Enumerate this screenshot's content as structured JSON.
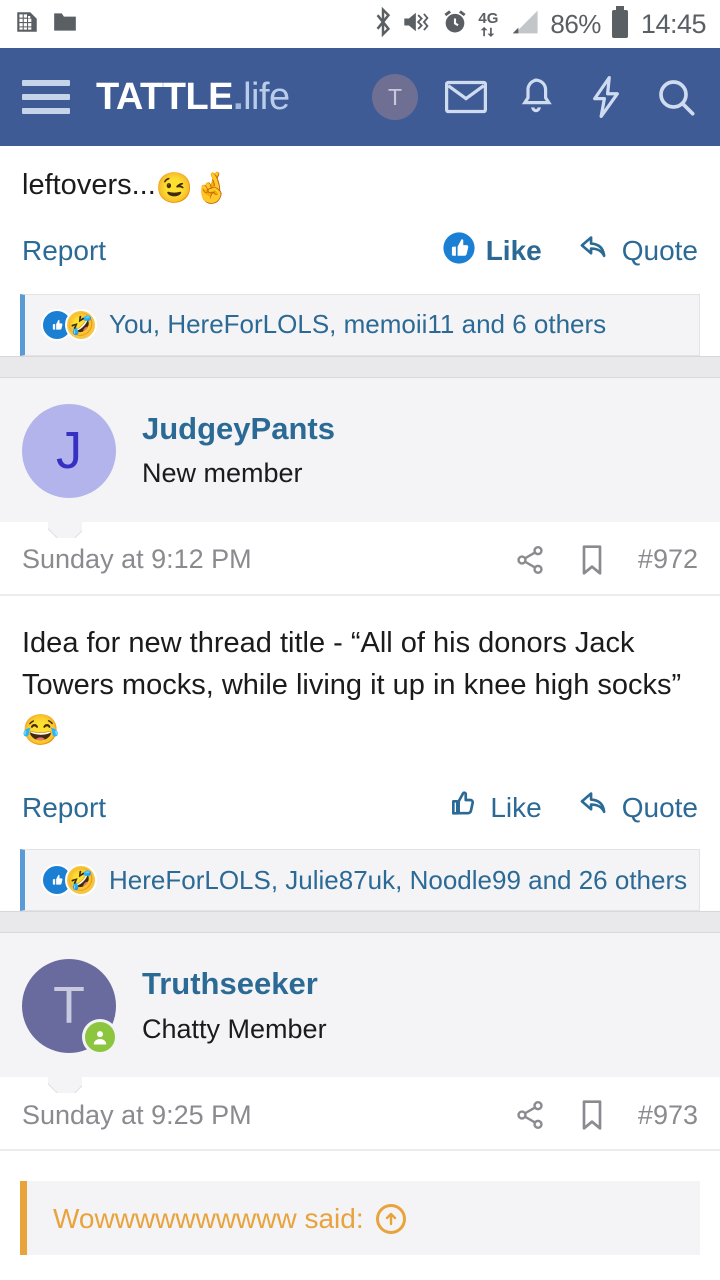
{
  "statusbar": {
    "icons": [
      "sim-card-icon",
      "folder-icon",
      "bluetooth-icon",
      "mute-vibrate-icon",
      "alarm-icon",
      "4g-data-icon",
      "signal-icon",
      "battery-icon"
    ],
    "network_label": "4G",
    "battery_percent": "86%",
    "clock": "14:45"
  },
  "navbar": {
    "menu_icon": "hamburger-menu-icon",
    "logo_main": "TATTLE",
    "logo_dot": ".",
    "logo_sub": "life",
    "avatar_initial": "T",
    "icons": [
      "inbox-icon",
      "alerts-bell-icon",
      "lightning-icon",
      "search-icon"
    ],
    "background": "#3f5b96"
  },
  "posts": [
    {
      "body_tail": "leftovers...",
      "body_emoji": [
        "😉",
        "🤞"
      ],
      "report_label": "Report",
      "like_label": "Like",
      "quote_label": "Quote",
      "liked": true,
      "reactions_text": "You, HereForLOLS, memoii11 and 6 others"
    },
    {
      "username": "JudgeyPants",
      "usertitle": "New member",
      "avatar_initial": "J",
      "avatar_bg": "#b3b4ec",
      "avatar_fg": "#3730c4",
      "online": false,
      "date": "Sunday at 9:12 PM",
      "post_number": "#972",
      "body": "Idea for new thread title - “All of his donors Jack Towers mocks, while living it up in knee high socks”",
      "body_emoji": "😂",
      "report_label": "Report",
      "like_label": "Like",
      "quote_label": "Quote",
      "liked": false,
      "reactions_text": "HereForLOLS, Julie87uk, Noodle99 and 26 others"
    },
    {
      "username": "Truthseeker",
      "usertitle": "Chatty Member",
      "avatar_initial": "T",
      "avatar_bg": "#696a9e",
      "avatar_fg": "#c9cade",
      "online": true,
      "date": "Sunday at 9:25 PM",
      "post_number": "#973",
      "quote_author": "Wowwwwwwwwww said:",
      "quote_jump_icon": "jump-to-post-arrow-icon"
    }
  ],
  "colors": {
    "navbar_blue": "#3f5b96",
    "link_blue": "#2c6a96",
    "reaction_accent": "#5b9bd5",
    "quote_accent": "#e8a33d",
    "online_green": "#8cc63f"
  }
}
